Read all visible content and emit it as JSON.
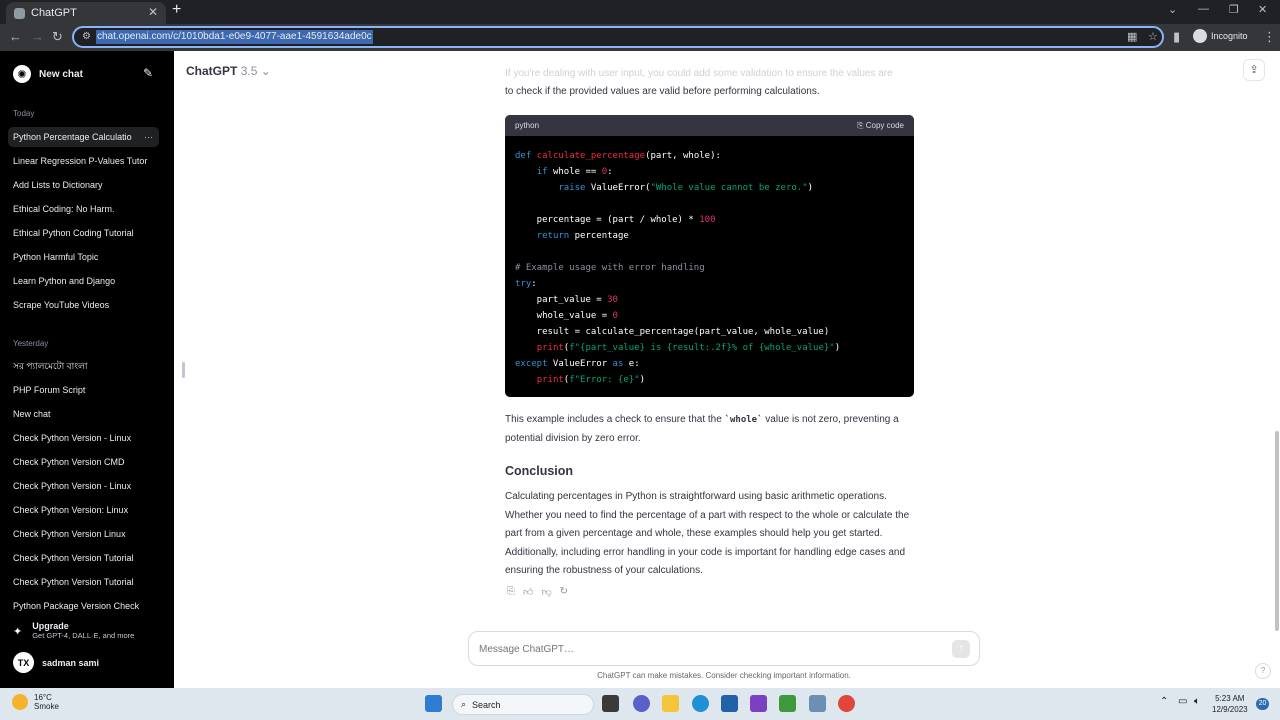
{
  "browser": {
    "tab_title": "ChatGPT",
    "url": "chat.openai.com/c/1010bda1-e0e9-4077-aae1-4591634ade0c",
    "incognito_label": "Incognito"
  },
  "sidebar": {
    "new_chat": "New chat",
    "groups": {
      "today": "Today",
      "yesterday": "Yesterday"
    },
    "today_items": [
      "Python Percentage Calculatio",
      "Linear Regression P-Values Tutor",
      "Add Lists to Dictionary",
      "Ethical Coding: No Harm.",
      "Ethical Python Coding Tutorial",
      "Python Harmful Topic",
      "Learn Python and Django",
      "Scrape YouTube Videos"
    ],
    "yesterday_items": [
      "সর প্যালমেটো বাংলা",
      "PHP Forum Script",
      "New chat",
      "Check Python Version - Linux",
      "Check Python Version CMD",
      "Check Python Version - Linux",
      "Check Python Version: Linux",
      "Check Python Version Linux",
      "Check Python Version Tutorial",
      "Check Python Version Tutorial",
      "Python Package Version Check"
    ],
    "upgrade_title": "Upgrade",
    "upgrade_subtitle": "Get GPT-4, DALL·E, and more",
    "user_initials": "TX",
    "user_name": "sadman sami"
  },
  "header": {
    "model_name": "ChatGPT",
    "model_version": "3.5"
  },
  "conversation": {
    "faded_line": "If you're dealing with user input, you could add some validation to ensure the values are",
    "intro": "to check if the provided values are valid before performing calculations.",
    "code_lang": "python",
    "copy_label": "Copy code",
    "after_code_pre": "This example includes a check to ensure that the ",
    "after_code_code": "`whole`",
    "after_code_post": " value is not zero, preventing a potential division by zero error.",
    "conclusion_title": "Conclusion",
    "conclusion_text": "Calculating percentages in Python is straightforward using basic arithmetic operations. Whether you need to find the percentage of a part with respect to the whole or calculate the part from a given percentage and whole, these examples should help you get started. Additionally, including error handling in your code is important for handling edge cases and ensuring the robustness of your calculations."
  },
  "composer": {
    "placeholder": "Message ChatGPT…",
    "disclaimer": "ChatGPT can make mistakes. Consider checking important information."
  },
  "taskbar": {
    "temperature": "16°C",
    "weather": "Smoke",
    "search_label": "Search",
    "time": "5:23 AM",
    "date": "12/9/2023",
    "notification_count": "20"
  }
}
